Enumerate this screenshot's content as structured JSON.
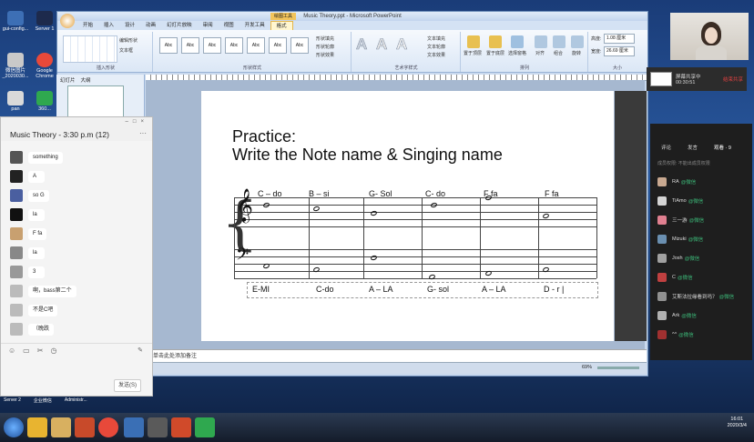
{
  "desktop": {
    "icons": [
      {
        "label": "gui-config...",
        "color": "#3d6fb5"
      },
      {
        "label": "Server 1",
        "color": "#1d2a4c"
      },
      {
        "label": "微信图片_2020030...",
        "color": "#c9c9c9"
      },
      {
        "label": "Google Chrome",
        "color": "#e8493a"
      },
      {
        "label": "pan",
        "color": "#d9d9d9"
      },
      {
        "label": "360...",
        "color": "#2fa84f"
      }
    ],
    "bottom_labels": [
      "Server 2",
      "企业微信",
      "Administr..."
    ]
  },
  "ppt": {
    "title": "Music Theory.ppt - Microsoft PowerPoint",
    "context_tab": "绘图工具",
    "tabs": [
      "开始",
      "插入",
      "设计",
      "动画",
      "幻灯片放映",
      "审阅",
      "视图",
      "开发工具",
      "格式"
    ],
    "active_tab": "格式",
    "ribbon": {
      "groups": [
        "插入形状",
        "形状样式",
        "艺术字样式",
        "排列",
        "大小"
      ],
      "edit_shape": "编辑形状",
      "textbox": "文本框",
      "shape_fill": "形状填充",
      "shape_outline": "形状轮廓",
      "shape_effects": "形状效果",
      "text_fill": "文本填充",
      "text_outline": "文本轮廓",
      "text_effects": "文本效果",
      "style_label": "Abc",
      "bring_front": "置于顶层",
      "send_back": "置于底层",
      "selection_pane": "选择窗格",
      "align": "对齐",
      "group": "组合",
      "rotate": "旋转",
      "height_label": "高度:",
      "height_value": "1.08 厘米",
      "width_label": "宽度:",
      "width_value": "26.69 厘米"
    },
    "thumb_tabs": [
      "幻灯片",
      "大纲"
    ],
    "notes_placeholder": "单击此处添加备注",
    "zoom": "69%"
  },
  "slide": {
    "title_line1": "Practice:",
    "title_line2": "Write the Note name & Singing name",
    "top_labels": [
      "C – do",
      "B – si",
      "G- Sol",
      "C- do",
      "F fa",
      "F fa"
    ],
    "bottom_labels": [
      "E-MI",
      "C-do",
      "A – LA",
      "G- sol",
      "A – LA",
      "D - r |"
    ]
  },
  "chat": {
    "title": "Music Theory - 3:30 p.m (12)",
    "more": "···",
    "messages": [
      {
        "text": "something",
        "avatar": "#555"
      },
      {
        "text": "A",
        "avatar": "#222"
      },
      {
        "text": "so G",
        "avatar": "#4a5fa0"
      },
      {
        "text": "la",
        "avatar": "#111"
      },
      {
        "text": "F fa",
        "avatar": "#c8a070"
      },
      {
        "text": "la",
        "avatar": "#888"
      },
      {
        "text": "3",
        "avatar": "#999"
      },
      {
        "text": "啊，bass第二个",
        "avatar": "#bbb"
      },
      {
        "text": "不是C吧",
        "avatar": "#bbb"
      },
      {
        "text": "（晚跌",
        "avatar": "#bbb"
      }
    ],
    "send_label": "发送(S)"
  },
  "share": {
    "status": "屏幕共享中",
    "time": "00:30:51",
    "stop": "结束共享"
  },
  "rpanel": {
    "tabs": [
      "评论",
      "发言",
      "观看 · 9"
    ],
    "note": "成员权限: 不能出成员权限",
    "members": [
      {
        "name": "RA",
        "tag": "@微信",
        "color": "#c8a890"
      },
      {
        "name": "TiAmo",
        "tag": "@微信",
        "color": "#d4d4d4"
      },
      {
        "name": "三一游",
        "tag": "@微信",
        "color": "#e08090"
      },
      {
        "name": "Mizuki",
        "tag": "@微信",
        "color": "#6a8fb0"
      },
      {
        "name": "Josh",
        "tag": "@微信",
        "color": "#a0a0a0"
      },
      {
        "name": "C",
        "tag": "@微信",
        "color": "#c04040"
      },
      {
        "name": "艾斯法拉缘看到吗？",
        "tag": "@微信",
        "color": "#909090"
      },
      {
        "name": "Ark",
        "tag": "@微信",
        "color": "#b0b0b0"
      },
      {
        "name": "^^",
        "tag": "@微信",
        "color": "#a03030"
      }
    ]
  },
  "taskbar": {
    "time": "16:01",
    "date": "2020/3/4"
  }
}
